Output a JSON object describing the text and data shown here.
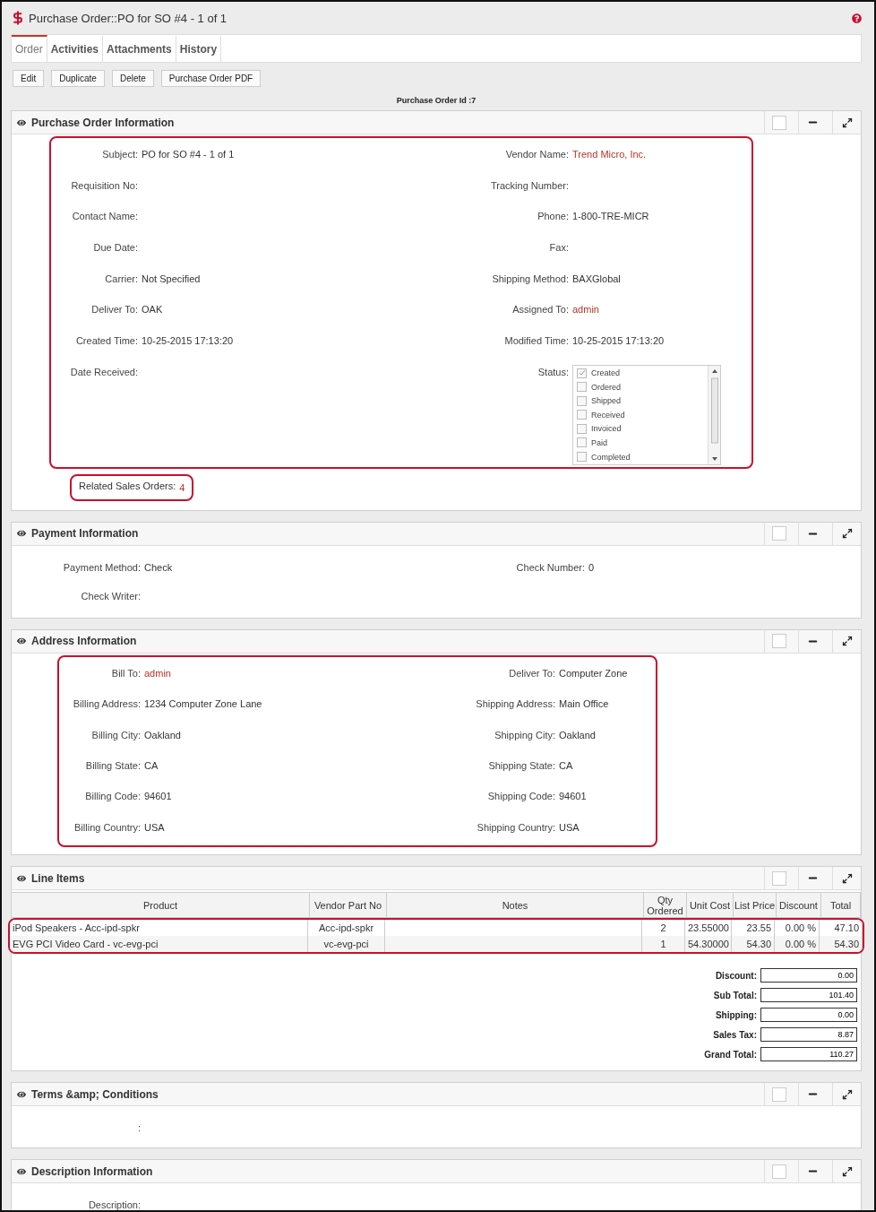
{
  "header": {
    "title": "Purchase Order::PO for SO #4 - 1 of 1"
  },
  "tabs": [
    {
      "label": "Order",
      "selected": true
    },
    {
      "label": "Activities",
      "selected": false
    },
    {
      "label": "Attachments",
      "selected": false
    },
    {
      "label": "History",
      "selected": false
    }
  ],
  "actions": [
    "Edit",
    "Duplicate",
    "Delete",
    "Purchase Order PDF"
  ],
  "record_id": "Purchase Order Id :7",
  "sections": [
    {
      "kind": "fields",
      "title": "Purchase Order Information",
      "highlighted": true,
      "rows": [
        [
          {
            "label": "Subject:",
            "value": "PO for SO #4 - 1 of 1",
            "link": false
          },
          {
            "label": "Vendor Name:",
            "value": "Trend Micro, Inc.",
            "link": true
          }
        ],
        [
          {
            "label": "Requisition No:"
          },
          {
            "label": "Tracking Number:"
          }
        ],
        [
          {
            "label": "Contact Name:"
          },
          {
            "label": "Phone:",
            "value": "1-800-TRE-MICR",
            "link": false
          }
        ],
        [
          {
            "label": "Due Date:"
          },
          {
            "label": "Fax:"
          }
        ],
        [
          {
            "label": "Carrier:",
            "value": "Not Specified",
            "link": false
          },
          {
            "label": "Shipping Method:",
            "value": "BAXGlobal",
            "link": false
          }
        ],
        [
          {
            "label": "Deliver To:",
            "value": "OAK",
            "link": false
          },
          {
            "label": "Assigned To:",
            "value": "admin",
            "link": true
          }
        ],
        [
          {
            "label": "Created Time:",
            "value": "10-25-2015 17:13:20",
            "link": false
          },
          {
            "label": "Modified Time:",
            "value": "10-25-2015 17:13:20",
            "link": false
          }
        ],
        [
          {
            "label": "Date Received:"
          },
          {
            "label": "Status:",
            "options": [
              {
                "label": "Created",
                "checked": true
              },
              {
                "label": "Ordered",
                "checked": false
              },
              {
                "label": "Shipped",
                "checked": false
              },
              {
                "label": "Received",
                "checked": false
              },
              {
                "label": "Invoiced",
                "checked": false
              },
              {
                "label": "Paid",
                "checked": false
              },
              {
                "label": "Completed",
                "checked": false
              }
            ]
          }
        ]
      ],
      "related": {
        "label": "Related Sales Orders:",
        "value": "4",
        "highlighted": true
      }
    },
    {
      "kind": "fields",
      "title": "Payment Information",
      "highlighted": false,
      "rows": [
        [
          {
            "label": "Payment Method:",
            "value": "Check",
            "link": false
          },
          {
            "label": "Check Number:",
            "value": "0",
            "link": false
          }
        ],
        [
          {
            "label": "Check Writer:"
          },
          null
        ]
      ]
    },
    {
      "kind": "fields",
      "title": "Address Information",
      "highlighted": true,
      "rows": [
        [
          {
            "label": "Bill To:",
            "value": "admin",
            "link": true
          },
          {
            "label": "Deliver To:",
            "value": "Computer Zone",
            "link": false
          }
        ],
        [
          {
            "label": "Billing Address:",
            "value": "1234 Computer Zone Lane",
            "link": false
          },
          {
            "label": "Shipping Address:",
            "value": "Main Office",
            "link": false
          }
        ],
        [
          {
            "label": "Billing City:",
            "value": "Oakland",
            "link": false
          },
          {
            "label": "Shipping City:",
            "value": "Oakland",
            "link": false
          }
        ],
        [
          {
            "label": "Billing State:",
            "value": "CA",
            "link": false
          },
          {
            "label": "Shipping State:",
            "value": "CA",
            "link": false
          }
        ],
        [
          {
            "label": "Billing Code:",
            "value": "94601",
            "link": false
          },
          {
            "label": "Shipping Code:",
            "value": "94601",
            "link": false
          }
        ],
        [
          {
            "label": "Billing Country:",
            "value": "USA",
            "link": false
          },
          {
            "label": "Shipping Country:",
            "value": "USA",
            "link": false
          }
        ]
      ]
    },
    {
      "kind": "line_items",
      "title": "Line Items",
      "highlighted": true,
      "columns": [
        "Product",
        "Vendor Part No",
        "Notes",
        "Qty Ordered",
        "Unit Cost",
        "List Price",
        "Discount",
        "Total"
      ],
      "rows": [
        [
          "iPod Speakers - Acc-ipd-spkr",
          "Acc-ipd-spkr",
          "",
          "2",
          "23.55000",
          "23.55",
          "0.00 %",
          "47.10"
        ],
        [
          "EVG PCI Video Card - vc-evg-pci",
          "vc-evg-pci",
          "",
          "1",
          "54.30000",
          "54.30",
          "0.00 %",
          "54.30"
        ]
      ],
      "totals": [
        {
          "label": "Discount:",
          "value": "0.00"
        },
        {
          "label": "Sub Total:",
          "value": "101.40"
        },
        {
          "label": "Shipping:",
          "value": "0.00"
        },
        {
          "label": "Sales Tax:",
          "value": "8.87"
        },
        {
          "label": "Grand Total:",
          "value": "110.27"
        }
      ]
    },
    {
      "kind": "fields",
      "title": "Terms &amp; Conditions",
      "highlighted": false,
      "rows": [
        [
          {
            "label": ":"
          },
          null
        ]
      ]
    },
    {
      "kind": "fields",
      "title": "Description Information",
      "highlighted": false,
      "rows": [
        [
          {
            "label": "Description:"
          },
          null
        ]
      ]
    }
  ]
}
